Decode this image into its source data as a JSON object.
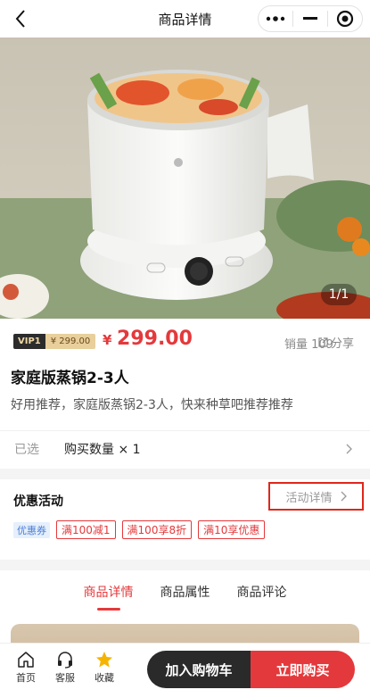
{
  "nav": {
    "title": "商品详情"
  },
  "hero": {
    "pager": "1/1"
  },
  "product": {
    "vip_tag": "VIP1",
    "vip_price": "¥ 299.00",
    "price_symbol": "¥",
    "price": "299.00",
    "sales": "销量 109",
    "share": "分享",
    "name": "家庭版蒸锅2-3人",
    "description": "好用推荐，家庭版蒸锅2-3人，快来种草吧推荐推荐",
    "selected_label": "已选",
    "selected_value": "购买数量 × 1"
  },
  "promo": {
    "title": "优惠活动",
    "detail": "活动详情",
    "coupon_tag": "优惠券",
    "coupons": [
      "满100减1",
      "满100享8折",
      "满10享优惠"
    ]
  },
  "tabs": [
    "商品详情",
    "商品属性",
    "商品评论"
  ],
  "bottombar": {
    "home": "首页",
    "service": "客服",
    "favorite": "收藏",
    "add_to_cart": "加入购物车",
    "buy_now": "立即购买"
  },
  "colors": {
    "accent": "#e4393c",
    "dark": "#2a2a2a",
    "star": "#f5b400",
    "highlight_box": "#e0261b"
  }
}
